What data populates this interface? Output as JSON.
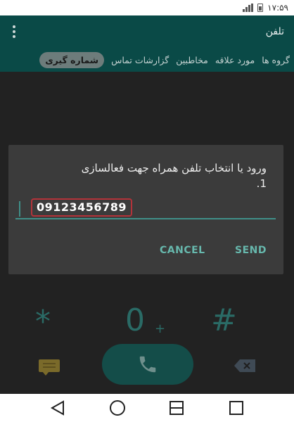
{
  "status_bar": {
    "time": "۱۷:۵۹"
  },
  "app_bar": {
    "title": "تلفن"
  },
  "tabs": [
    {
      "label": "گروه ها"
    },
    {
      "label": "مورد علاقه"
    },
    {
      "label": "مخاطبین"
    },
    {
      "label": "گزارشات تماس"
    },
    {
      "label": "شماره گیری",
      "active": true
    }
  ],
  "dialog": {
    "message": "ورود یا انتخاب تلفن همراه جهت فعالسازی",
    "message_number": "1.",
    "input_value": "09123456789",
    "cancel_label": "CANCEL",
    "send_label": "SEND"
  },
  "dialpad": {
    "star": "*",
    "zero": "0",
    "zero_sub": "+",
    "hash": "#"
  },
  "icons": {
    "sms": "message-icon",
    "call": "phone-icon",
    "backspace": "backspace-icon",
    "nav_back": "back-triangle-icon",
    "nav_home": "home-circle-icon",
    "nav_dual_sim": "dual-window-icon",
    "nav_recents": "recents-square-icon"
  },
  "colors": {
    "accent": "#67b8ad",
    "app_bar": "#0a4a47",
    "input_highlight": "#b3333a"
  }
}
